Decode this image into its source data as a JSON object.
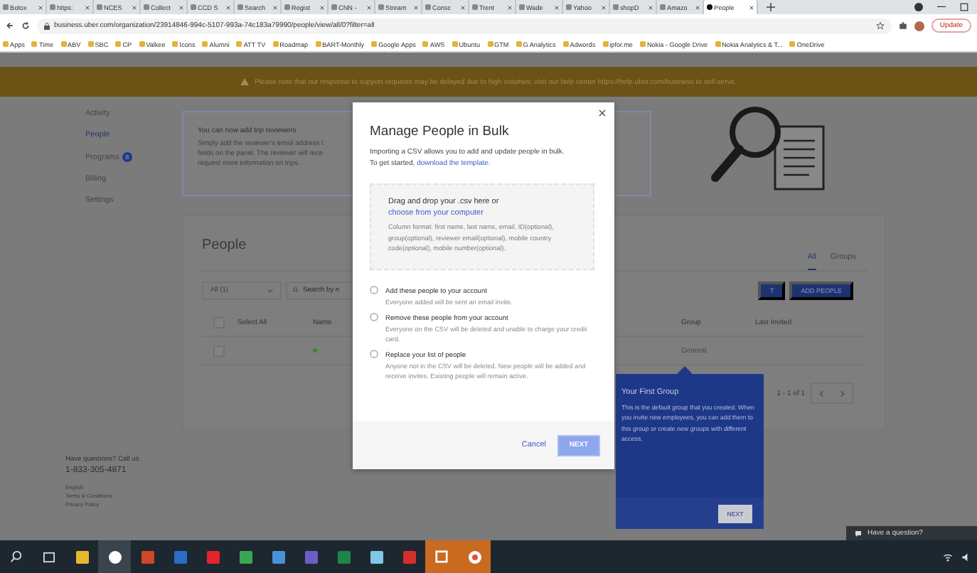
{
  "browser": {
    "tabs": [
      {
        "label": "Botox",
        "selected": false
      },
      {
        "label": "https:",
        "selected": false
      },
      {
        "label": "NCES",
        "selected": false
      },
      {
        "label": "Collect",
        "selected": false
      },
      {
        "label": "CCD S",
        "selected": false
      },
      {
        "label": "Search",
        "selected": false
      },
      {
        "label": "Regist",
        "selected": false
      },
      {
        "label": "CNN -",
        "selected": false
      },
      {
        "label": "Stream",
        "selected": false
      },
      {
        "label": "Consc",
        "selected": false
      },
      {
        "label": "Trent",
        "selected": false
      },
      {
        "label": "Wade",
        "selected": false
      },
      {
        "label": "Yahoo",
        "selected": false
      },
      {
        "label": "shopD",
        "selected": false
      },
      {
        "label": "Amazo",
        "selected": false
      },
      {
        "label": "People",
        "selected": true
      }
    ],
    "address": "business.uber.com/organization/23914846-994c-5107-993a-74c183a79990/people/view/all/0?filter=all",
    "update_button": "Update",
    "bookmarks": [
      "Apps",
      "Time",
      "ABV",
      "SBC",
      "CP",
      "Valkee",
      "Icons",
      "Alumni",
      "ATT TV",
      "Roadmap",
      "BART-Monthly",
      "Google Apps",
      "AWS",
      "Ubuntu",
      "GTM",
      "G Analytics",
      "Adwords",
      "ipfor.me",
      "Nokia - Google Drive",
      "Nokia Analytics & T...",
      "OneDrive"
    ]
  },
  "banner": "Please note that our response to support requests may be delayed due to high volumes; visit our help center https://help.uber.com/business to self-serve.",
  "sidebar": [
    {
      "label": "Activity",
      "selected": false
    },
    {
      "label": "People",
      "selected": true
    },
    {
      "label": "Programs",
      "selected": false,
      "badge": "8"
    },
    {
      "label": "Billing",
      "selected": false
    },
    {
      "label": "Settings",
      "selected": false
    }
  ],
  "notice": {
    "title": "You can now add trip reviewers",
    "lines": [
      "Simply add the reviewer's email address t",
      "fields on the panel. The reviewer will rece",
      "request more information on trips."
    ]
  },
  "people": {
    "title": "People",
    "tabs": [
      {
        "label": "All",
        "selected": true
      },
      {
        "label": "Groups",
        "selected": false
      }
    ],
    "select_all_checked": false,
    "filter": "All (1)",
    "search_placeholder": "Search by n",
    "cut_button": "T",
    "add_button": "ADD PEOPLE",
    "columns": [
      "Select All",
      "Name",
      "Group",
      "Last Invited"
    ],
    "rows": [
      {
        "selected": false,
        "color": "#2f8a1e",
        "group": "General"
      }
    ],
    "pagination": "1 - 1 of 1"
  },
  "modal": {
    "title": "Manage People in Bulk",
    "intro": "Importing a CSV allows you to add and update people in bulk.",
    "intro_prefix": "To get started,",
    "intro_link": "download the template.",
    "drop_text": "Drag and drop your .csv here or",
    "drop_link": "choose from your computer",
    "format": "Column format: first name, last name, email, ID(optional), group(optional), reviewer email(optional), mobile country code(optional), mobile number(optional).",
    "options": [
      {
        "title": "Add these people to your account",
        "description": "Everyone added will be sent an email invite.",
        "selected": false
      },
      {
        "title": "Remove these people from your account",
        "description": "Everyone on the CSV will be deleted and unable to charge your credit card.",
        "selected": false
      },
      {
        "title": "Replace your list of people",
        "description": "Anyone not in the CSV will be deleted. New people will be added and receive invites. Existing people will remain active.",
        "selected": false
      }
    ],
    "cancel": "Cancel",
    "next": "NEXT",
    "next_disabled": true
  },
  "tooltip": {
    "title": "Your First Group",
    "body": "This is the default group that you created. When you invite new employees, you can add them to this group or create new groups with different access.",
    "button": "NEXT"
  },
  "footer": {
    "question": "Have questions? Call us",
    "phone": "1-833-305-4871",
    "links": [
      "English",
      "Terms & Conditions",
      "Privacy Policy"
    ]
  },
  "chat": "Have a question?"
}
